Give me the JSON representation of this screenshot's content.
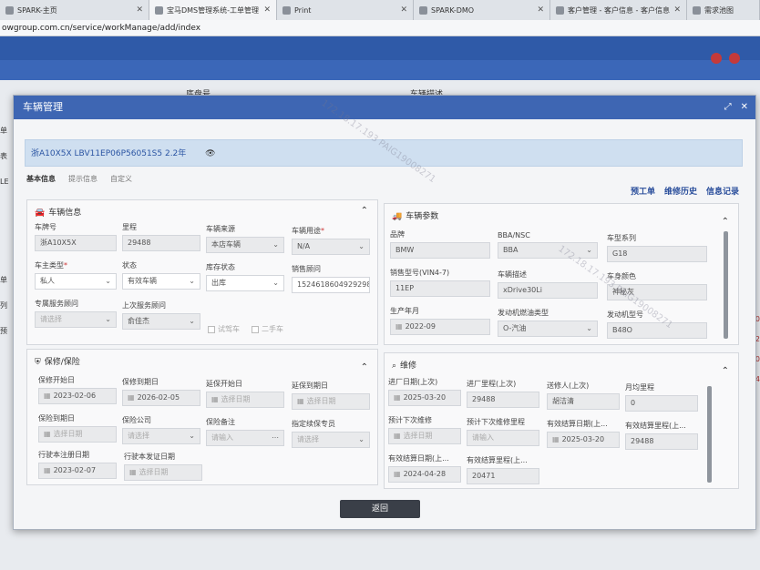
{
  "browser": {
    "tabs": [
      {
        "label": "SPARK-主页"
      },
      {
        "label": "宝马DMS管理系统-工单管理"
      },
      {
        "label": "Print"
      },
      {
        "label": "SPARK-DMO"
      },
      {
        "label": "客户管理 - 客户信息 - 客户信息"
      },
      {
        "label": "需求池图"
      }
    ],
    "url": "owgroup.com.cn/service/workManage/add/index"
  },
  "background": {
    "col_chassis": "底盘号",
    "col_vehicle_desc": "车辆描述",
    "side_left": [
      "单表",
      "LE",
      "单列",
      "预"
    ],
    "side_right": [
      "250",
      "12",
      "230",
      "24"
    ]
  },
  "modal": {
    "title": "车辆管理",
    "vin_banner": "浙A10X5X LBV11EP06P56051S5 2.2年",
    "subtabs": [
      "基本信息",
      "提示信息",
      "自定义"
    ],
    "right_links": [
      "预工单",
      "维修历史",
      "信息记录"
    ],
    "vehicle_info": {
      "title": "车辆信息",
      "fields": {
        "plate_label": "车牌号",
        "plate_value": "浙A10X5X",
        "mileage_label": "里程",
        "mileage_value": "29488",
        "source_label": "车辆来源",
        "source_value": "本店车辆",
        "usage_label": "车辆用途",
        "usage_value": "N/A",
        "owner_type_label": "车主类型",
        "owner_type_value": "私人",
        "status_label": "状态",
        "status_value": "有效车辆",
        "stock_label": "库存状态",
        "stock_value": "出库",
        "sales_advisor_label": "销售顾问",
        "sales_advisor_value": "15246186049292982-",
        "exclusive_label": "专属服务顾问",
        "exclusive_value": "请选择",
        "last_service_label": "上次服务顾问",
        "last_service_value": "俞佳杰",
        "check_1": "试驾车",
        "check_2": "二手车"
      }
    },
    "vehicle_params": {
      "title": "车辆参数",
      "fields": {
        "brand_label": "品牌",
        "brand_value": "BMW",
        "bba_label": "BBA/NSC",
        "bba_value": "BBA",
        "series_label": "车型系列",
        "series_value": "G18",
        "model_label": "销售型号(VIN4-7)",
        "model_value": "11EP",
        "desc_label": "车辆描述",
        "desc_value": "xDrive30Li",
        "color_label": "车身颜色",
        "color_value": "神秘灰",
        "prod_label": "生产年月",
        "prod_value": "2022-09",
        "fuel_label": "发动机燃油类型",
        "fuel_value": "O-汽油",
        "engine_label": "发动机型号",
        "engine_value": "B48O"
      }
    },
    "warranty": {
      "title": "保修/保险",
      "fields": {
        "w_start_label": "保修开始日",
        "w_start_value": "2023-02-06",
        "w_end_label": "保修到期日",
        "w_end_value": "2026-02-05",
        "ext_start_label": "延保开始日",
        "ext_start_value": "选择日期",
        "ext_end_label": "延保到期日",
        "ext_end_value": "选择日期",
        "ins_end_label": "保险到期日",
        "ins_end_value": "选择日期",
        "ins_co_label": "保险公司",
        "ins_co_value": "请选择",
        "ins_note_label": "保险备注",
        "ins_note_value": "请输入",
        "spec_label": "指定续保专员",
        "spec_value": "请选择",
        "reg_label": "行驶本注册日期",
        "reg_value": "2023-02-07",
        "issue_label": "行驶本发证日期",
        "issue_value": "选择日期"
      }
    },
    "maintenance": {
      "title": "维修",
      "fields": {
        "last_in_label": "进厂日期(上次)",
        "last_in_value": "2025-03-20",
        "last_mile_label": "进厂里程(上次)",
        "last_mile_value": "29488",
        "last_person_label": "送修人(上次)",
        "last_person_value": "胡洁清",
        "avg_label": "月均里程",
        "avg_value": "0",
        "next_date_label": "预计下次维修",
        "next_date_value": "选择日期",
        "next_mile_label": "预计下次维修里程",
        "next_mile_value": "请输入",
        "valid_date_label": "有效结算日期(上...",
        "valid_date_value": "2025-03-20",
        "valid_mile_label": "有效结算里程(上...",
        "valid_mile_value": "29488",
        "settle_date_label": "有效结算日期(上...",
        "settle_date_value": "2024-04-28",
        "settle_mile_label": "有效结算里程(上...",
        "settle_mile_value": "20471"
      }
    },
    "back_button": "返回"
  },
  "watermark": "172.18.17.193  PAIG19008271",
  "colors": {
    "primary": "#3e66b3",
    "header": "#2f5aa8",
    "banner": "#cfdff0",
    "button": "#3a3f48"
  }
}
